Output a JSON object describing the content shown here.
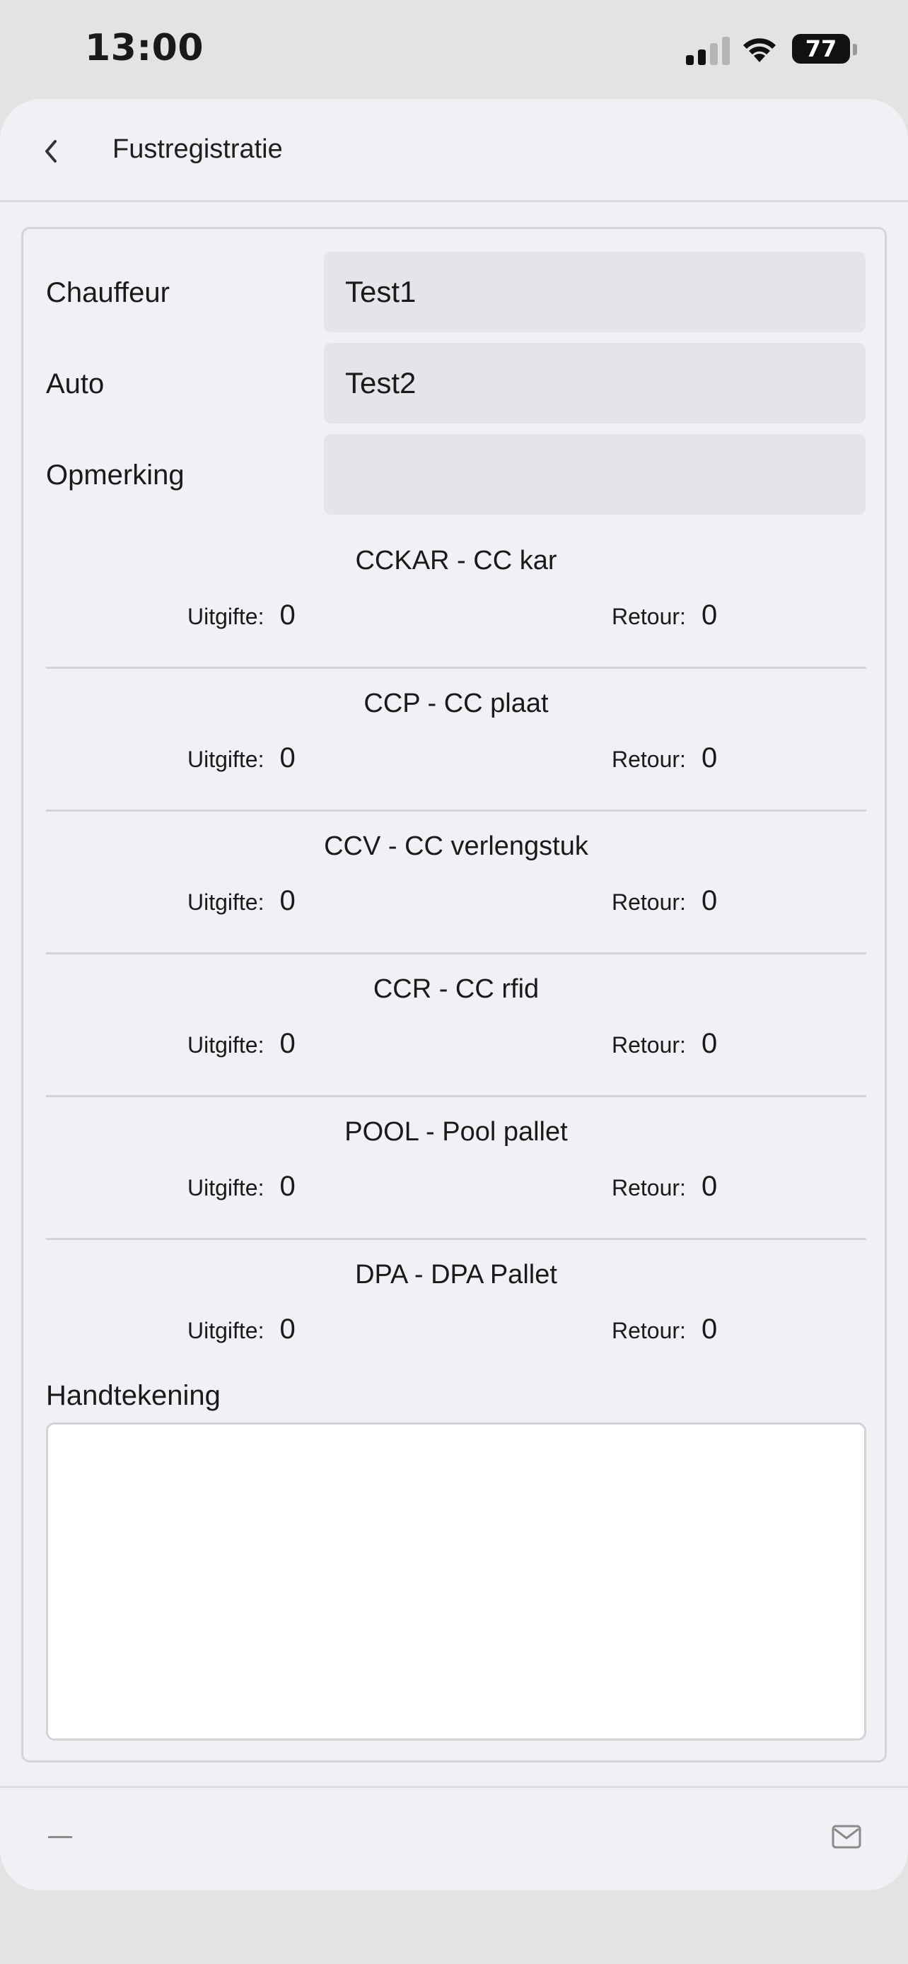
{
  "status_bar": {
    "time": "13:00",
    "battery": "77"
  },
  "header": {
    "title": "Fustregistratie"
  },
  "fields": {
    "chauffeur": {
      "label": "Chauffeur",
      "value": "Test1"
    },
    "auto": {
      "label": "Auto",
      "value": "Test2"
    },
    "opmerking": {
      "label": "Opmerking",
      "value": ""
    }
  },
  "items": [
    {
      "title": "CCKAR - CC kar",
      "uitgifte_label": "Uitgifte:",
      "uitgifte": "0",
      "retour_label": "Retour:",
      "retour": "0"
    },
    {
      "title": "CCP - CC plaat",
      "uitgifte_label": "Uitgifte:",
      "uitgifte": "0",
      "retour_label": "Retour:",
      "retour": "0"
    },
    {
      "title": "CCV - CC verlengstuk",
      "uitgifte_label": "Uitgifte:",
      "uitgifte": "0",
      "retour_label": "Retour:",
      "retour": "0"
    },
    {
      "title": "CCR - CC rfid",
      "uitgifte_label": "Uitgifte:",
      "uitgifte": "0",
      "retour_label": "Retour:",
      "retour": "0"
    },
    {
      "title": "POOL - Pool pallet",
      "uitgifte_label": "Uitgifte:",
      "uitgifte": "0",
      "retour_label": "Retour:",
      "retour": "0"
    },
    {
      "title": "DPA - DPA Pallet",
      "uitgifte_label": "Uitgifte:",
      "uitgifte": "0",
      "retour_label": "Retour:",
      "retour": "0"
    }
  ],
  "signature": {
    "label": "Handtekening"
  },
  "icons": {
    "back": "chevron-left-icon",
    "minimize": "minus-icon",
    "mail": "mail-icon",
    "signal": "cellular-signal-icon",
    "wifi": "wifi-icon",
    "battery": "battery-icon"
  },
  "colors": {
    "background": "#e3e3e3",
    "sheet": "#f0f1f5",
    "input": "#e4e5e9",
    "divider": "#d1d3d7",
    "signature_pad": "#ffffff"
  }
}
